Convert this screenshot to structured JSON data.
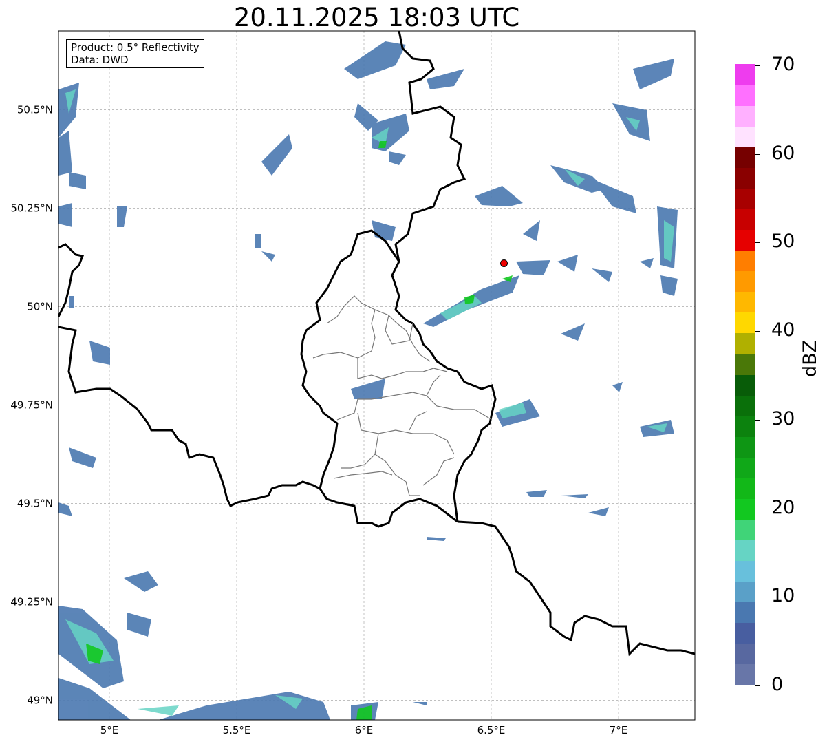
{
  "title": "20.11.2025 18:03 UTC",
  "info": {
    "product": "Product: 0.5° Reflectivity",
    "data": "Data: DWD"
  },
  "map": {
    "lon_range": [
      4.8,
      7.3
    ],
    "lat_range": [
      48.95,
      50.7
    ],
    "x_ticks": [
      {
        "value": 5.0,
        "label": "5°E"
      },
      {
        "value": 5.5,
        "label": "5.5°E"
      },
      {
        "value": 6.0,
        "label": "6°E"
      },
      {
        "value": 6.5,
        "label": "6.5°E"
      },
      {
        "value": 7.0,
        "label": "7°E"
      }
    ],
    "y_ticks": [
      {
        "value": 49.0,
        "label": "49°N"
      },
      {
        "value": 49.25,
        "label": "49.25°N"
      },
      {
        "value": 49.5,
        "label": "49.5°N"
      },
      {
        "value": 49.75,
        "label": "49.75°N"
      },
      {
        "value": 50.0,
        "label": "50°N"
      },
      {
        "value": 50.25,
        "label": "50.25°N"
      },
      {
        "value": 50.5,
        "label": "50.5°N"
      }
    ],
    "grid": true,
    "radar_site": {
      "lon": 6.55,
      "lat": 50.11,
      "color": "#ee0000"
    }
  },
  "colorbar": {
    "label": "dBZ",
    "min": 0,
    "max": 70,
    "ticks": [
      0,
      10,
      20,
      30,
      40,
      50,
      60,
      70
    ],
    "colors": [
      "#6876a8",
      "#5868a0",
      "#485ea0",
      "#4a78b0",
      "#5aa0c8",
      "#68c0dc",
      "#66d4c4",
      "#40d478",
      "#12c820",
      "#12b818",
      "#10a818",
      "#0e9614",
      "#0c820e",
      "#0a700a",
      "#085c08",
      "#4a7808",
      "#b0b000",
      "#ffd800",
      "#ffb800",
      "#ff9a00",
      "#ff7e00",
      "#e60000",
      "#c80000",
      "#a80000",
      "#8a0000",
      "#760000",
      "#ffe2ff",
      "#ffb0ff",
      "#ff70ff",
      "#ee3cee"
    ]
  }
}
